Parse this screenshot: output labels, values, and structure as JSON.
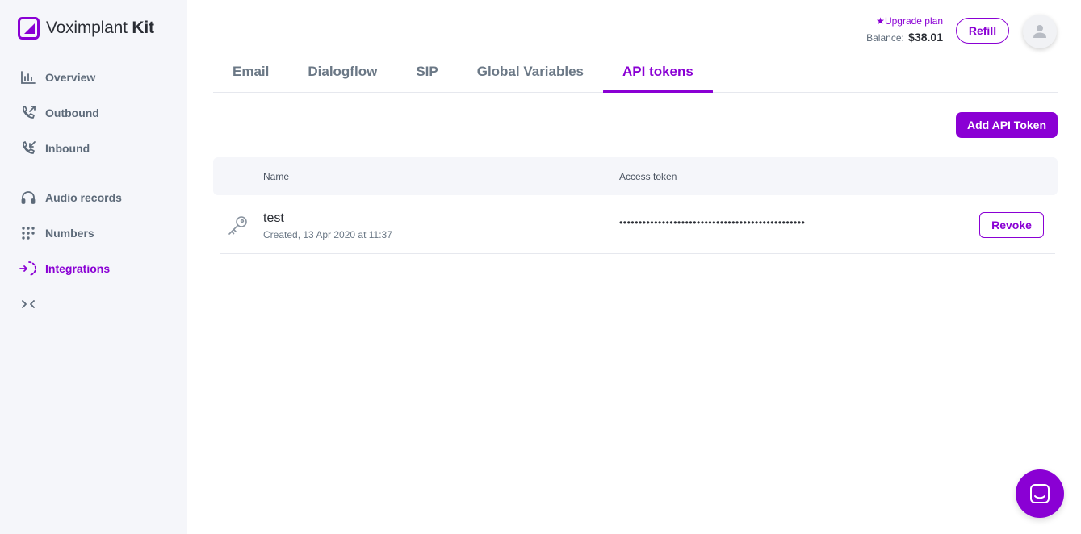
{
  "app": {
    "brand_light": "Voximplant",
    "brand_bold": "Kit",
    "accent_color": "#8a00d4"
  },
  "sidebar": {
    "items": [
      {
        "label": "Overview",
        "icon": "chart-icon"
      },
      {
        "label": "Outbound",
        "icon": "outbound-call-icon"
      },
      {
        "label": "Inbound",
        "icon": "inbound-call-icon"
      },
      {
        "label": "Audio records",
        "icon": "headphones-icon"
      },
      {
        "label": "Numbers",
        "icon": "dialpad-icon"
      },
      {
        "label": "Integrations",
        "icon": "integrations-icon",
        "active": true
      }
    ],
    "collapse_icon": "collapse-icon"
  },
  "header": {
    "upgrade_label": "Upgrade plan",
    "balance_label": "Balance:",
    "balance_value": "$38.01",
    "refill_label": "Refill"
  },
  "tabs": [
    {
      "label": "Email"
    },
    {
      "label": "Dialogflow"
    },
    {
      "label": "SIP"
    },
    {
      "label": "Global Variables"
    },
    {
      "label": "API tokens",
      "active": true
    }
  ],
  "actions": {
    "add_token_label": "Add API Token"
  },
  "table": {
    "columns": [
      "Name",
      "Access token"
    ],
    "rows": [
      {
        "name": "test",
        "created": "Created, 13 Apr 2020 at 11:37",
        "token_masked": "••••••••••••••••••••••••••••••••••••••••••••••••",
        "revoke_label": "Revoke"
      }
    ]
  }
}
